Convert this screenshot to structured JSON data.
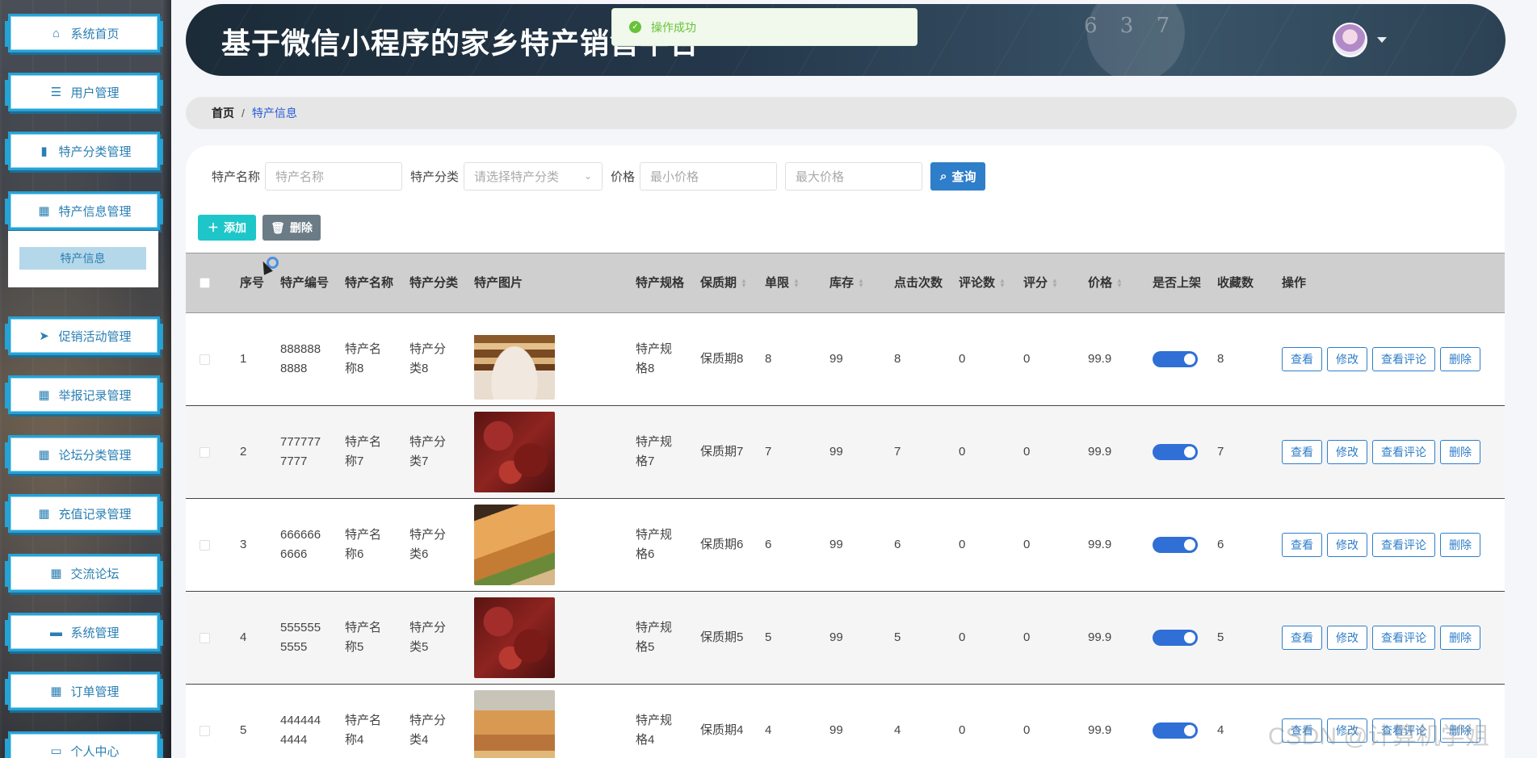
{
  "sidebar": {
    "items": [
      {
        "label": "系统首页",
        "icon": "home-icon"
      },
      {
        "label": "用户管理",
        "icon": "menu-lines-icon"
      },
      {
        "label": "特产分类管理",
        "icon": "bar-chart-icon"
      },
      {
        "label": "特产信息管理",
        "icon": "grid-icon"
      },
      {
        "label": "促销活动管理",
        "icon": "paper-plane-icon"
      },
      {
        "label": "举报记录管理",
        "icon": "grid-icon"
      },
      {
        "label": "论坛分类管理",
        "icon": "grid-icon"
      },
      {
        "label": "充值记录管理",
        "icon": "grid-icon"
      },
      {
        "label": "交流论坛",
        "icon": "grid-icon"
      },
      {
        "label": "系统管理",
        "icon": "monitor-icon"
      },
      {
        "label": "订单管理",
        "icon": "grid-icon"
      },
      {
        "label": "个人中心",
        "icon": "card-icon"
      }
    ],
    "submenu_label": "特产信息"
  },
  "header": {
    "title": "基于微信小程序的家乡特产销售平台",
    "deco_numbers": "6 3 7"
  },
  "toast": {
    "message": "操作成功",
    "color": "#67c23a"
  },
  "breadcrumb": {
    "home": "首页",
    "separator": "/",
    "current": "特产信息"
  },
  "search": {
    "name_label": "特产名称",
    "name_placeholder": "特产名称",
    "category_label": "特产分类",
    "category_placeholder": "请选择特产分类",
    "price_label": "价格",
    "min_placeholder": "最小价格",
    "max_placeholder": "最大价格",
    "query_label": "查询"
  },
  "toolbar": {
    "add_label": "添加",
    "delete_label": "删除"
  },
  "table": {
    "headers": {
      "index": "序号",
      "code": "特产编号",
      "name": "特产名称",
      "category": "特产分类",
      "image": "特产图片",
      "spec": "特产规格",
      "shelf": "保质期",
      "limit": "单限",
      "stock": "库存",
      "clicks": "点击次数",
      "comments": "评论数",
      "score": "评分",
      "price": "价格",
      "on_sale": "是否上架",
      "favorites": "收藏数",
      "ops": "操作"
    },
    "actions": {
      "view": "查看",
      "edit": "修改",
      "view_comments": "查看评论",
      "delete": "删除"
    },
    "rows": [
      {
        "index": "1",
        "code1": "888888",
        "code2": "8888",
        "name1": "特产名",
        "name2": "称8",
        "cat1": "特产分",
        "cat2": "类8",
        "spec1": "特产规",
        "spec2": "格8",
        "shelf": "保质期8",
        "limit": "8",
        "stock": "99",
        "clicks": "8",
        "comments": "0",
        "score": "0",
        "price": "99.9",
        "favorites": "8",
        "image": "tofu-image"
      },
      {
        "index": "2",
        "code1": "777777",
        "code2": "7777",
        "name1": "特产名",
        "name2": "称7",
        "cat1": "特产分",
        "cat2": "类7",
        "spec1": "特产规",
        "spec2": "格7",
        "shelf": "保质期7",
        "limit": "7",
        "stock": "99",
        "clicks": "7",
        "comments": "0",
        "score": "0",
        "price": "99.9",
        "favorites": "7",
        "image": "meat-image"
      },
      {
        "index": "3",
        "code1": "666666",
        "code2": "6666",
        "name1": "特产名",
        "name2": "称6",
        "cat1": "特产分",
        "cat2": "类6",
        "spec1": "特产规",
        "spec2": "格6",
        "shelf": "保质期6",
        "limit": "6",
        "stock": "99",
        "clicks": "6",
        "comments": "0",
        "score": "0",
        "price": "99.9",
        "favorites": "6",
        "image": "cake-image"
      },
      {
        "index": "4",
        "code1": "555555",
        "code2": "5555",
        "name1": "特产名",
        "name2": "称5",
        "cat1": "特产分",
        "cat2": "类5",
        "spec1": "特产规",
        "spec2": "格5",
        "shelf": "保质期5",
        "limit": "5",
        "stock": "99",
        "clicks": "5",
        "comments": "0",
        "score": "0",
        "price": "99.9",
        "favorites": "5",
        "image": "meat-image"
      },
      {
        "index": "5",
        "code1": "444444",
        "code2": "4444",
        "name1": "特产名",
        "name2": "称4",
        "cat1": "特产分",
        "cat2": "类4",
        "spec1": "特产规",
        "spec2": "格4",
        "shelf": "保质期4",
        "limit": "4",
        "stock": "99",
        "clicks": "4",
        "comments": "0",
        "score": "0",
        "price": "99.9",
        "favorites": "4",
        "image": "chips-image"
      }
    ]
  },
  "watermark": "CSDN @计算机学姐",
  "colors": {
    "accent": "#27a2d5",
    "primary": "#2f7ec9",
    "add": "#1ec6c9",
    "toggle": "#2f6fd6"
  }
}
